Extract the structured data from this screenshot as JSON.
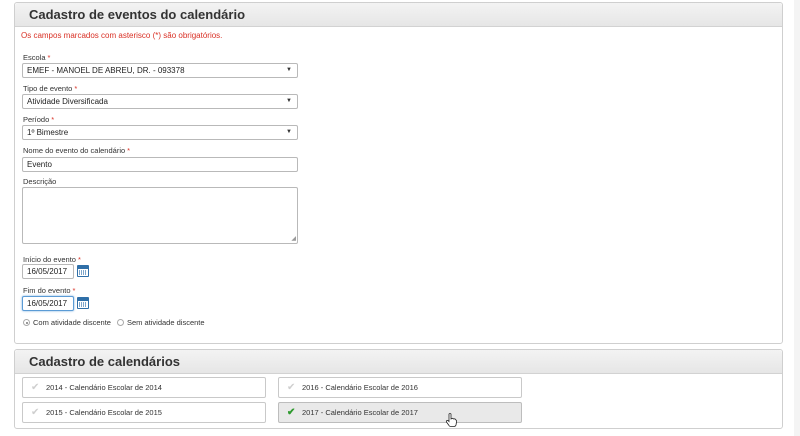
{
  "event_form": {
    "title": "Cadastro de eventos do calendário",
    "required_note": "Os campos marcados com asterisco (*) são obrigatórios.",
    "escola": {
      "label": "Escola",
      "value": "EMEF - MANOEL DE ABREU, DR. - 093378"
    },
    "tipo": {
      "label": "Tipo de evento",
      "value": "Atividade Diversificada"
    },
    "periodo": {
      "label": "Período",
      "value": "1º Bimestre"
    },
    "nome": {
      "label": "Nome do evento do calendário",
      "value": "Evento"
    },
    "descricao": {
      "label": "Descrição",
      "value": ""
    },
    "inicio": {
      "label": "Início do evento",
      "value": "16/05/2017"
    },
    "fim": {
      "label": "Fim do evento",
      "value": "16/05/2017"
    },
    "radios": [
      {
        "label": "Com atividade discente",
        "checked": true
      },
      {
        "label": "Sem atividade discente",
        "checked": false
      }
    ],
    "required_mark": "*"
  },
  "calendars": {
    "title": "Cadastro de calendários",
    "items": [
      {
        "label": "2014 - Calendário Escolar de 2014",
        "selected": false
      },
      {
        "label": "2016 - Calendário Escolar de 2016",
        "selected": false
      },
      {
        "label": "2015 - Calendário Escolar de 2015",
        "selected": false
      },
      {
        "label": "2017 - Calendário Escolar de 2017",
        "selected": true
      }
    ]
  },
  "icons": {
    "check": "checkmark-icon",
    "calendar": "calendar-icon",
    "dropdown": "dropdown-arrow-icon"
  },
  "colors": {
    "required": "#d93025",
    "check_active": "#2e9a2e",
    "calendar_icon": "#2f6fa8"
  }
}
